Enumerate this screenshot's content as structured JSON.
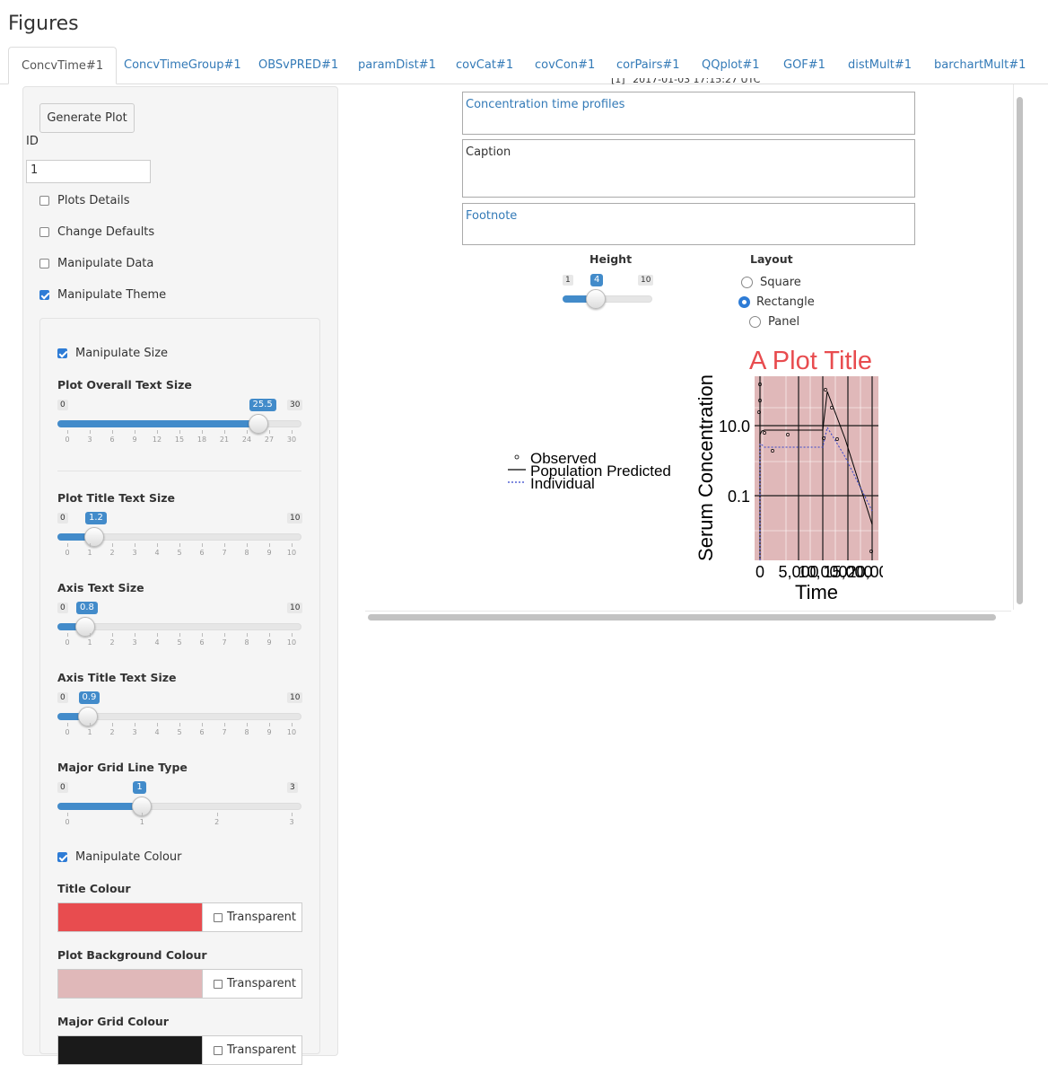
{
  "page": {
    "title": "Figures"
  },
  "tabs": [
    {
      "label": "ConcvTime#1",
      "active": true
    },
    {
      "label": "ConcvTimeGroup#1"
    },
    {
      "label": "OBSvPRED#1"
    },
    {
      "label": "paramDist#1"
    },
    {
      "label": "covCat#1"
    },
    {
      "label": "covCon#1"
    },
    {
      "label": "corPairs#1"
    },
    {
      "label": "QQplot#1"
    },
    {
      "label": "GOF#1"
    },
    {
      "label": "distMult#1"
    },
    {
      "label": "barchartMult#1"
    }
  ],
  "sidebar": {
    "generate_label": "Generate Plot",
    "id_label": "ID",
    "id_value": "1",
    "options": [
      {
        "label": "Plots Details",
        "checked": false
      },
      {
        "label": "Change Defaults",
        "checked": false
      },
      {
        "label": "Manipulate Data",
        "checked": false
      },
      {
        "label": "Manipulate Theme",
        "checked": true
      }
    ],
    "manipulate_size_label": "Manipulate Size",
    "sliders": [
      {
        "label": "Plot Overall Text Size",
        "min": "0",
        "max": "30",
        "value": 25.5,
        "value_label": "25.5",
        "ticks": [
          "0",
          "3",
          "6",
          "9",
          "12",
          "15",
          "18",
          "21",
          "24",
          "27",
          "30"
        ]
      },
      {
        "label": "Plot Title Text Size",
        "min": "0",
        "max": "10",
        "value": 1.2,
        "value_label": "1.2",
        "ticks": [
          "0",
          "1",
          "2",
          "3",
          "4",
          "5",
          "6",
          "7",
          "8",
          "9",
          "10"
        ]
      },
      {
        "label": "Axis Text Size",
        "min": "0",
        "max": "10",
        "value": 0.8,
        "value_label": "0.8",
        "ticks": [
          "0",
          "1",
          "2",
          "3",
          "4",
          "5",
          "6",
          "7",
          "8",
          "9",
          "10"
        ]
      },
      {
        "label": "Axis Title Text Size",
        "min": "0",
        "max": "10",
        "value": 0.9,
        "value_label": "0.9",
        "ticks": [
          "0",
          "1",
          "2",
          "3",
          "4",
          "5",
          "6",
          "7",
          "8",
          "9",
          "10"
        ]
      },
      {
        "label": "Major Grid Line Type",
        "min": "0",
        "max": "3",
        "value": 1,
        "value_label": "1",
        "ticks": [
          "0",
          "1",
          "2",
          "3"
        ]
      }
    ],
    "manipulate_colour_label": "Manipulate Colour",
    "colours": [
      {
        "label": "Title Colour",
        "color": "#e84c4f",
        "transparent_label": "Transparent"
      },
      {
        "label": "Plot Background Colour",
        "color": "#e0b8b9",
        "transparent_label": "Transparent"
      },
      {
        "label": "Major Grid Colour",
        "color": "#1a1a1a",
        "transparent_label": "Transparent"
      }
    ]
  },
  "main": {
    "timestamp": "[1] \"2017-01-03 17:15:27 UTC\"",
    "title_text": "Concentration time profiles",
    "caption_text": "Caption",
    "footnote_text": "Footnote",
    "height": {
      "label": "Height",
      "min": "1",
      "max": "10",
      "value": 4,
      "value_label": "4"
    },
    "layout": {
      "label": "Layout",
      "options": [
        {
          "label": "Square",
          "selected": false
        },
        {
          "label": "Rectangle",
          "selected": true
        },
        {
          "label": "Panel",
          "selected": false
        }
      ]
    }
  },
  "chart_data": {
    "type": "line",
    "title": "A Plot Title",
    "xlabel": "Time",
    "ylabel": "Serum Concentration",
    "x_ticks": [
      "0",
      "5,000",
      "10,000",
      "15,000",
      "20,000"
    ],
    "y_ticks": [
      "0.1",
      "10.0"
    ],
    "y_scale": "log",
    "title_color": "#e84c4f",
    "background_color": "#e0b8b9",
    "grid_color": "#1a1a1a",
    "legend": [
      "Observed",
      "Population Predicted",
      "Individual"
    ],
    "legend_position": "left"
  }
}
